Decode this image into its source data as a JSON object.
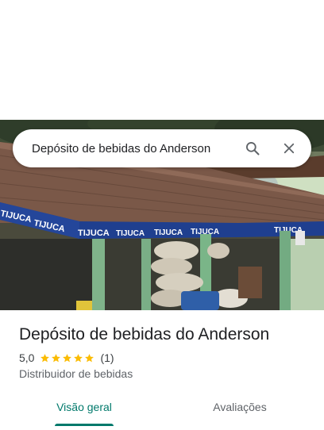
{
  "search": {
    "query": "Depósito de bebidas do Anderson"
  },
  "place": {
    "name": "Depósito de bebidas do Anderson",
    "rating": "5,0",
    "stars": 5,
    "review_count": "(1)",
    "category": "Distribuidor de bebidas"
  },
  "photo": {
    "signs": [
      "TIJUCA",
      "TIJUCA",
      "TIJUCA",
      "TIJUCA",
      "TIJUCA",
      "TIJUCA",
      "TIJUCA"
    ]
  },
  "tabs": [
    {
      "label": "Visão geral",
      "active": true
    },
    {
      "label": "Avaliações",
      "active": false
    }
  ],
  "icons": {
    "search": "search-icon",
    "close": "close-icon",
    "star": "star-icon"
  },
  "colors": {
    "accent": "#00796b",
    "star": "#fbbc04",
    "text": "#202124",
    "secondary_text": "#5f6368"
  }
}
